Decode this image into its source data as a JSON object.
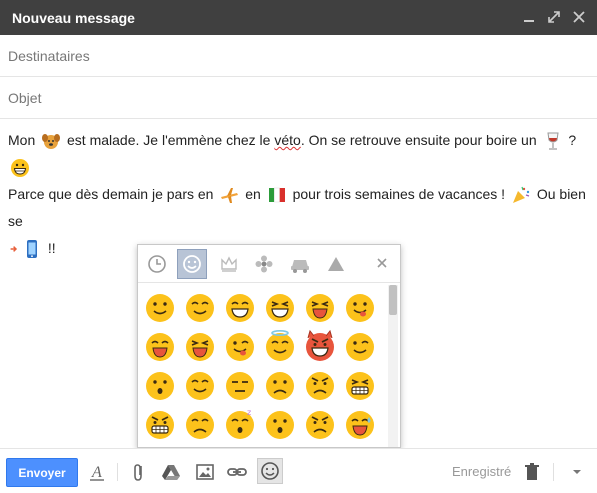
{
  "window": {
    "title": "Nouveau message"
  },
  "fields": {
    "to_placeholder": "Destinataires",
    "subject_placeholder": "Objet"
  },
  "message": {
    "seg1": "Mon",
    "seg2": "est malade. Je l'emmène chez le",
    "typo": "véto",
    "seg3": ". On se retrouve ensuite pour boire un",
    "seg4": "?",
    "seg5": "Parce que dès demain je pars en",
    "seg6": "en",
    "seg7": "pour trois semaines de vacances !",
    "seg8": "Ou bien se",
    "seg9": "!!"
  },
  "inline_emojis": [
    "dog-emoji",
    "wine-glass-emoji",
    "grinning-emoji",
    "airplane-emoji",
    "italy-flag-emoji",
    "party-popper-emoji",
    "arrow-emoji",
    "mobile-phone-emoji"
  ],
  "emoji_picker": {
    "tabs": [
      "clock-icon",
      "smiley-icon",
      "crown-icon",
      "flower-icon",
      "car-icon",
      "triangle-icon"
    ],
    "active_tab": "smiley-icon",
    "emojis": [
      "smile",
      "smile-closed",
      "grin-wide",
      "grin-big",
      "laugh",
      "tongue-out",
      "happy-blush",
      "happy-squint",
      "wink-laugh",
      "angel",
      "devil",
      "wink",
      "stuck-hand",
      "pleased",
      "neutral",
      "confused",
      "angry-eyebrows",
      "grimace",
      "tired",
      "sad-down",
      "sleepy",
      "surprised",
      "upset",
      "cold-sweat"
    ]
  },
  "toolbar": {
    "send_label": "Envoyer",
    "saved_label": "Enregistré"
  },
  "colors": {
    "titlebar": "#404040",
    "send": "#4d90fe",
    "emoji_yellow": "#fcc21b"
  }
}
